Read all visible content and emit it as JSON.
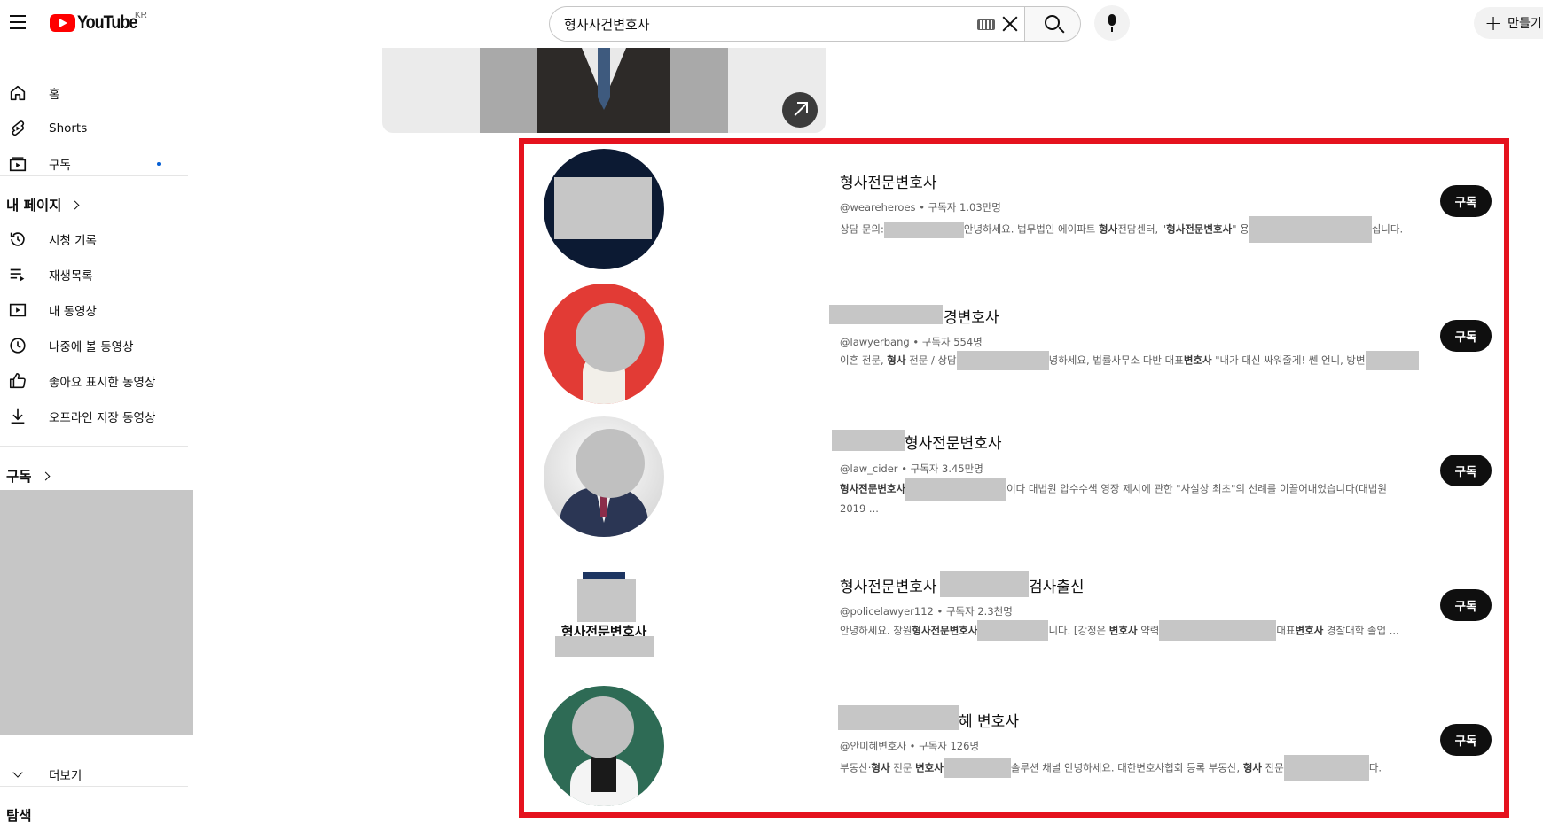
{
  "header": {
    "logo_text": "YouTube",
    "region": "KR",
    "search_value": "형사사건변호사",
    "create_label": "만들기"
  },
  "sidebar": {
    "main": [
      {
        "label": "홈",
        "icon": "home-icon"
      },
      {
        "label": "Shorts",
        "icon": "shorts-icon"
      },
      {
        "label": "구독",
        "icon": "subscriptions-icon"
      }
    ],
    "you_title": "내 페이지",
    "you_items": [
      {
        "label": "시청 기록",
        "icon": "history-icon"
      },
      {
        "label": "재생목록",
        "icon": "playlist-icon"
      },
      {
        "label": "내 동영상",
        "icon": "my-videos-icon"
      },
      {
        "label": "나중에 볼 동영상",
        "icon": "watch-later-icon"
      },
      {
        "label": "좋아요 표시한 동영상",
        "icon": "like-icon"
      },
      {
        "label": "오프라인 저장 동영상",
        "icon": "download-icon"
      }
    ],
    "subscriptions_title": "구독",
    "more_label": "더보기",
    "explore_title": "탐색"
  },
  "channels": [
    {
      "name": "형사전문변호사",
      "handle": "@weareheroes",
      "subs": "구독자 1.03만명",
      "desc_parts": [
        "상담 문의:",
        "안녕하세요. 법무법인 에이파트 ",
        "형사",
        "전담센터, \"",
        "형사전문변호사",
        "\" 용",
        "십니다."
      ],
      "subscribe_label": "구독"
    },
    {
      "name": "경변호사",
      "handle": "@lawyerbang",
      "subs": "구독자 554명",
      "desc_parts": [
        "이혼 전문, ",
        "형사",
        " 전문 / 상담",
        "녕하세요, 법률사무소 다반 대표",
        "변호사",
        " \"내가 대신 싸워줄게! 쎈 언니, 방변"
      ],
      "subscribe_label": "구독"
    },
    {
      "name": "형사전문변호사",
      "handle": "@law_cider",
      "subs": "구독자 3.45만명",
      "desc_parts": [
        "형사전문변호사",
        "이다 대법원 압수수색 영장 제시에 관한 \"사실상 최초\"의 선례를 이끌어내었습니다(대법원",
        "2019 ..."
      ],
      "subscribe_label": "구독"
    },
    {
      "name_start": "형사전문변호사",
      "name_end": "검사출신",
      "handle": "@policelawyer112",
      "subs": "구독자 2.3천명",
      "logo_text": "형사전문변호사",
      "desc_parts": [
        "안녕하세요. 창원",
        "형사전문변호사",
        "니다. [강정은 ",
        "변호사",
        " 약력",
        "대표",
        "변호사",
        " 경찰대학 졸업 ..."
      ],
      "subscribe_label": "구독"
    },
    {
      "name": "혜 변호사",
      "handle": "@안미혜변호사",
      "subs": "구독자 126명",
      "desc_parts": [
        "부동산·",
        "형사",
        " 전문 ",
        "변호사",
        "솔루션 채널 안녕하세요. 대한변호사협회 등록 부동산, ",
        "형사",
        " 전문",
        "다."
      ],
      "subscribe_label": "구독"
    }
  ],
  "meta_separator": "•"
}
